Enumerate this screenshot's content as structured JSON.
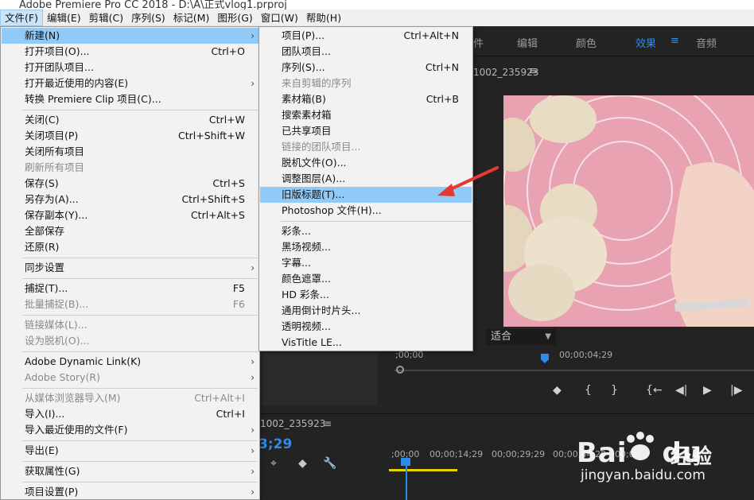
{
  "window": {
    "title": "Adobe Premiere Pro CC 2018 - D:\\A\\正式vlog1.prproj"
  },
  "menubar": [
    "文件(F)",
    "编辑(E)",
    "剪辑(C)",
    "序列(S)",
    "标记(M)",
    "图形(G)",
    "窗口(W)",
    "帮助(H)"
  ],
  "workspaces": {
    "partial": "件",
    "edit": "编辑",
    "color": "颜色",
    "effects": "效果",
    "menu_glyph": "≡",
    "audio": "音频"
  },
  "program_monitor": {
    "sequence": "1002_235923",
    "menu_glyph": "≡",
    "fit": "适合",
    "tc_start": ";00;00",
    "tc_mid": "00;00;04;29"
  },
  "transport": [
    "◆",
    "{",
    "}",
    "{←",
    "◀|",
    "▶",
    "|▶"
  ],
  "timeline": {
    "sequence": "1002_235923",
    "menu_glyph": "≡",
    "timecode": "3;29",
    "ruler": [
      ";00;00",
      "00;00;14;29",
      "00;00;29;29",
      "00;00;44;28",
      "00;00"
    ]
  },
  "file_menu": [
    {
      "label": "新建(N)",
      "shortcut": "",
      "submenu": true,
      "disabled": false,
      "highlight": true
    },
    {
      "label": "打开项目(O)...",
      "shortcut": "Ctrl+O",
      "submenu": false,
      "disabled": false
    },
    {
      "label": "打开团队项目...",
      "shortcut": "",
      "submenu": false,
      "disabled": false
    },
    {
      "label": "打开最近使用的内容(E)",
      "shortcut": "",
      "submenu": true,
      "disabled": false
    },
    {
      "label": "转换 Premiere Clip 项目(C)...",
      "shortcut": "",
      "submenu": false,
      "disabled": false
    },
    {
      "label": "关闭(C)",
      "shortcut": "Ctrl+W",
      "submenu": false,
      "disabled": false
    },
    {
      "label": "关闭项目(P)",
      "shortcut": "Ctrl+Shift+W",
      "submenu": false,
      "disabled": false
    },
    {
      "label": "关闭所有项目",
      "shortcut": "",
      "submenu": false,
      "disabled": false
    },
    {
      "label": "刷新所有项目",
      "shortcut": "",
      "submenu": false,
      "disabled": true
    },
    {
      "label": "保存(S)",
      "shortcut": "Ctrl+S",
      "submenu": false,
      "disabled": false
    },
    {
      "label": "另存为(A)...",
      "shortcut": "Ctrl+Shift+S",
      "submenu": false,
      "disabled": false
    },
    {
      "label": "保存副本(Y)...",
      "shortcut": "Ctrl+Alt+S",
      "submenu": false,
      "disabled": false
    },
    {
      "label": "全部保存",
      "shortcut": "",
      "submenu": false,
      "disabled": false
    },
    {
      "label": "还原(R)",
      "shortcut": "",
      "submenu": false,
      "disabled": false
    },
    {
      "label": "同步设置",
      "shortcut": "",
      "submenu": true,
      "disabled": false
    },
    {
      "label": "捕捉(T)...",
      "shortcut": "F5",
      "submenu": false,
      "disabled": false
    },
    {
      "label": "批量捕捉(B)...",
      "shortcut": "F6",
      "submenu": false,
      "disabled": true
    },
    {
      "label": "链接媒体(L)...",
      "shortcut": "",
      "submenu": false,
      "disabled": true
    },
    {
      "label": "设为脱机(O)...",
      "shortcut": "",
      "submenu": false,
      "disabled": true
    },
    {
      "label": "Adobe Dynamic Link(K)",
      "shortcut": "",
      "submenu": true,
      "disabled": false
    },
    {
      "label": "Adobe Story(R)",
      "shortcut": "",
      "submenu": true,
      "disabled": true
    },
    {
      "label": "从媒体浏览器导入(M)",
      "shortcut": "Ctrl+Alt+I",
      "submenu": false,
      "disabled": true
    },
    {
      "label": "导入(I)...",
      "shortcut": "Ctrl+I",
      "submenu": false,
      "disabled": false
    },
    {
      "label": "导入最近使用的文件(F)",
      "shortcut": "",
      "submenu": true,
      "disabled": false
    },
    {
      "label": "导出(E)",
      "shortcut": "",
      "submenu": true,
      "disabled": false
    },
    {
      "label": "获取属性(G)",
      "shortcut": "",
      "submenu": true,
      "disabled": false
    },
    {
      "label": "项目设置(P)",
      "shortcut": "",
      "submenu": true,
      "disabled": false
    }
  ],
  "new_menu": [
    {
      "label": "项目(P)...",
      "shortcut": "Ctrl+Alt+N",
      "disabled": false
    },
    {
      "label": "团队项目...",
      "shortcut": "",
      "disabled": false
    },
    {
      "label": "序列(S)...",
      "shortcut": "Ctrl+N",
      "disabled": false
    },
    {
      "label": "来自剪辑的序列",
      "shortcut": "",
      "disabled": true
    },
    {
      "label": "素材箱(B)",
      "shortcut": "Ctrl+B",
      "disabled": false
    },
    {
      "label": "搜索素材箱",
      "shortcut": "",
      "disabled": false
    },
    {
      "label": "已共享项目",
      "shortcut": "",
      "disabled": false
    },
    {
      "label": "链接的团队项目...",
      "shortcut": "",
      "disabled": true
    },
    {
      "label": "脱机文件(O)...",
      "shortcut": "",
      "disabled": false
    },
    {
      "label": "调整图层(A)...",
      "shortcut": "",
      "disabled": false
    },
    {
      "label": "旧版标题(T)...",
      "shortcut": "",
      "disabled": false,
      "highlight": true
    },
    {
      "label": "Photoshop 文件(H)...",
      "shortcut": "",
      "disabled": false
    },
    {
      "label": "彩条...",
      "shortcut": "",
      "disabled": false
    },
    {
      "label": "黑场视频...",
      "shortcut": "",
      "disabled": false
    },
    {
      "label": "字幕...",
      "shortcut": "",
      "disabled": false
    },
    {
      "label": "颜色遮罩...",
      "shortcut": "",
      "disabled": false
    },
    {
      "label": "HD 彩条...",
      "shortcut": "",
      "disabled": false
    },
    {
      "label": "通用倒计时片头...",
      "shortcut": "",
      "disabled": false
    },
    {
      "label": "透明视频...",
      "shortcut": "",
      "disabled": false
    },
    {
      "label": "VisTitle LE...",
      "shortcut": "",
      "disabled": false
    }
  ],
  "watermark": {
    "brand": "Bai",
    "brand2": "du",
    "jingyan": "经验",
    "url": "jingyan.baidu.com"
  },
  "colors": {
    "highlight": "#91c9f7",
    "accent": "#2d8ceb",
    "annotation": "#e53935"
  }
}
